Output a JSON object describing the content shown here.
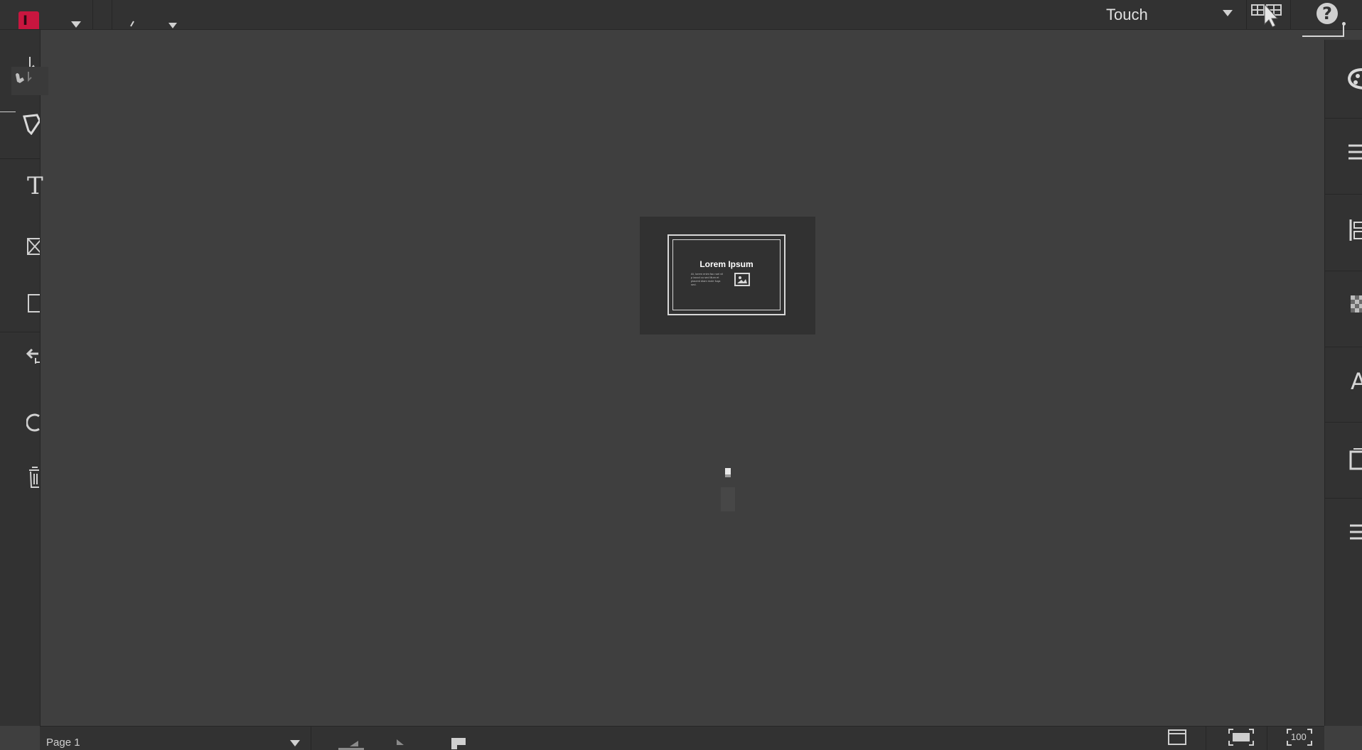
{
  "topbar": {
    "workspace": "Touch",
    "icons": [
      "app-logo-icon",
      "dropdown-arrow-icon",
      "grid-view-icon",
      "cursor-icon",
      "help-icon"
    ]
  },
  "app": {
    "logo_letter": "I",
    "accent_color": "#c8163f"
  },
  "left_toolbar": {
    "tools": [
      "selection-icon",
      "hand-icon",
      "pen-icon",
      "type-icon",
      "rectangle-frame-icon",
      "rectangle-icon",
      "undo-icon",
      "ellipse-icon",
      "trash-icon"
    ]
  },
  "right_panel": {
    "icons": [
      "color-palette-icon",
      "list-icon",
      "align-icon",
      "swatches-icon",
      "character-icon",
      "pages-icon",
      "menu-icon"
    ]
  },
  "canvas": {
    "preview_card": {
      "title": "Lorem Ipsum",
      "body": "At, lorem enim fac nari vil p iaccd cu sed illum et placent diam mole fuqa sed."
    }
  },
  "bottombar": {
    "page_label": "Page 1",
    "zoom_label": "100"
  }
}
